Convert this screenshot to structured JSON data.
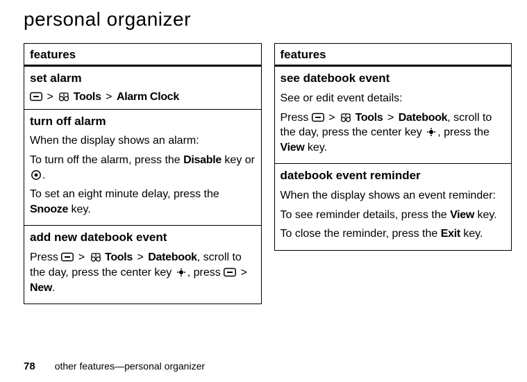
{
  "page_title": "personal organizer",
  "page_number": "78",
  "footer_text": "other features—personal organizer",
  "table_header": "features",
  "sep": ">",
  "labels": {
    "tools": "Tools",
    "alarm_clock": "Alarm Clock",
    "datebook": "Datebook",
    "new": "New",
    "disable": "Disable",
    "snooze": "Snooze",
    "view": "View",
    "exit": "Exit"
  },
  "left": {
    "r1_title": "set alarm",
    "r2_title": "turn off alarm",
    "r2_p1": "When the display shows an alarm:",
    "r2_p2a": "To turn off the alarm, press the ",
    "r2_p2b": " key or ",
    "r2_p2c": ".",
    "r2_p3a": "To set an eight minute delay, press the ",
    "r2_p3b": " key.",
    "r3_title": "add new datebook event",
    "r3_p1a": "Press ",
    "r3_p1b": ", scroll to the day, press the center key ",
    "r3_p1c": ", press ",
    "r3_p1d": "."
  },
  "right": {
    "r1_title": "see datebook event",
    "r1_p1": "See or edit event details:",
    "r1_p2a": "Press ",
    "r1_p2b": ", scroll to the day, press the center key ",
    "r1_p2c": ", press the ",
    "r1_p2d": " key.",
    "r2_title": "datebook event reminder",
    "r2_p1": "When the display shows an event reminder:",
    "r2_p2a": "To see reminder details, press the ",
    "r2_p2b": " key.",
    "r2_p3a": "To close the reminder, press the ",
    "r2_p3b": " key."
  }
}
